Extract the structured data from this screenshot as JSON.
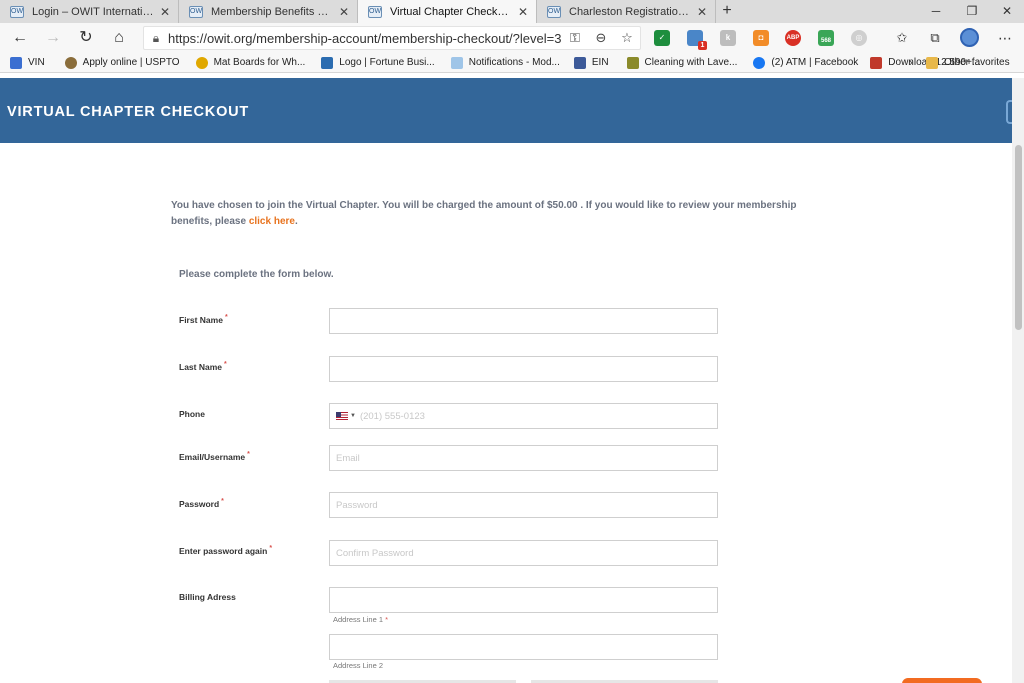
{
  "browser": {
    "tabs": [
      {
        "title": "Login – OWIT International"
      },
      {
        "title": "Membership Benefits of OWIT –"
      },
      {
        "title": "Virtual Chapter Checkout – OWIT"
      },
      {
        "title": "Charleston Registration – OWIT"
      }
    ],
    "active_tab": 2,
    "url": "https://owit.org/membership-account/membership-checkout/?level=3",
    "extension_badges": {
      "count_badge": "1",
      "number_badge": "568",
      "abp": "ABP"
    },
    "bookmarks": [
      {
        "label": "VIN",
        "color": "#3b6fd1"
      },
      {
        "label": "Apply online | USPTO",
        "color": "#8a6d3b"
      },
      {
        "label": "Mat Boards for Wh...",
        "color": "#e0a800"
      },
      {
        "label": "Logo | Fortune Busi...",
        "color": "#2b6cb0"
      },
      {
        "label": "Notifications - Mod...",
        "color": "#9fc5e8"
      },
      {
        "label": "EIN",
        "color": "#3d5a99"
      },
      {
        "label": "Cleaning with Lave...",
        "color": "#8a8a2a"
      },
      {
        "label": "(2) ATM | Facebook",
        "color": "#1877f2"
      },
      {
        "label": "Download 12.590+...",
        "color": "#c0392b"
      }
    ],
    "other_favorites": "Other favorites"
  },
  "page": {
    "banner_title": "VIRTUAL CHAPTER CHECKOUT",
    "intro_text": "You have chosen to join the Virtual Chapter. You will be charged the amount of $50.00 .  If you would like to review your membership benefits, please ",
    "intro_link": "click here",
    "intro_end": ".",
    "instruction": "Please complete the form below.",
    "fields": {
      "first_name": {
        "label": "First Name",
        "placeholder": "",
        "value": ""
      },
      "last_name": {
        "label": "Last Name",
        "placeholder": "",
        "value": ""
      },
      "phone": {
        "label": "Phone",
        "placeholder": "(201) 555-0123",
        "value": ""
      },
      "email": {
        "label": "Email/Username",
        "placeholder": "Email",
        "value": ""
      },
      "password": {
        "label": "Password",
        "placeholder": "Password",
        "value": ""
      },
      "password_again": {
        "label": "Enter password again",
        "placeholder": "Confirm Password",
        "value": ""
      },
      "billing": {
        "label": "Billing Adress",
        "line1_label": "Address Line 1",
        "line2_label": "Address Line 2"
      }
    },
    "required_mark": "*"
  }
}
